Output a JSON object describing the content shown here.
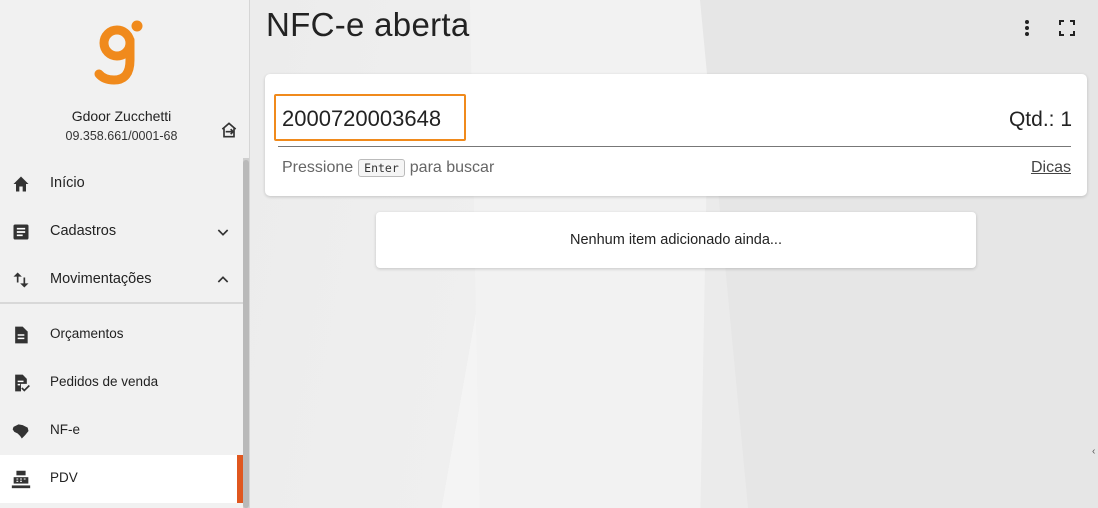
{
  "sidebar": {
    "company_name": "Gdoor Zucchetti",
    "company_cnpj": "09.358.661/0001-68",
    "logout_icon": "logout-icon",
    "brand_color": "#f08a1c",
    "items": [
      {
        "label": "Início",
        "icon": "home-icon"
      },
      {
        "label": "Cadastros",
        "icon": "list-icon",
        "chevron": "chevron-down-icon"
      },
      {
        "label": "Movimentações",
        "icon": "swap-vertical-icon",
        "chevron": "chevron-up-icon"
      },
      {
        "label": "Orçamentos",
        "icon": "document-icon"
      },
      {
        "label": "Pedidos de venda",
        "icon": "document-check-icon"
      },
      {
        "label": "NF-e",
        "icon": "brazil-map-icon"
      },
      {
        "label": "PDV",
        "icon": "cash-register-icon",
        "active": true
      }
    ],
    "active_color": "#e0571f"
  },
  "main": {
    "title": "NFC-e aberta",
    "more_icon": "more-vertical-icon",
    "fullscreen_icon": "fullscreen-icon",
    "search": {
      "value": "2000720003648",
      "placeholder": "",
      "qty_label": "Qtd.: 1",
      "hint_before": "Pressione",
      "hint_key": "Enter",
      "hint_after": "para buscar",
      "tips_link": "Dicas",
      "highlight_color": "#f08a1c"
    },
    "empty_message": "Nenhum item adicionado ainda..."
  }
}
